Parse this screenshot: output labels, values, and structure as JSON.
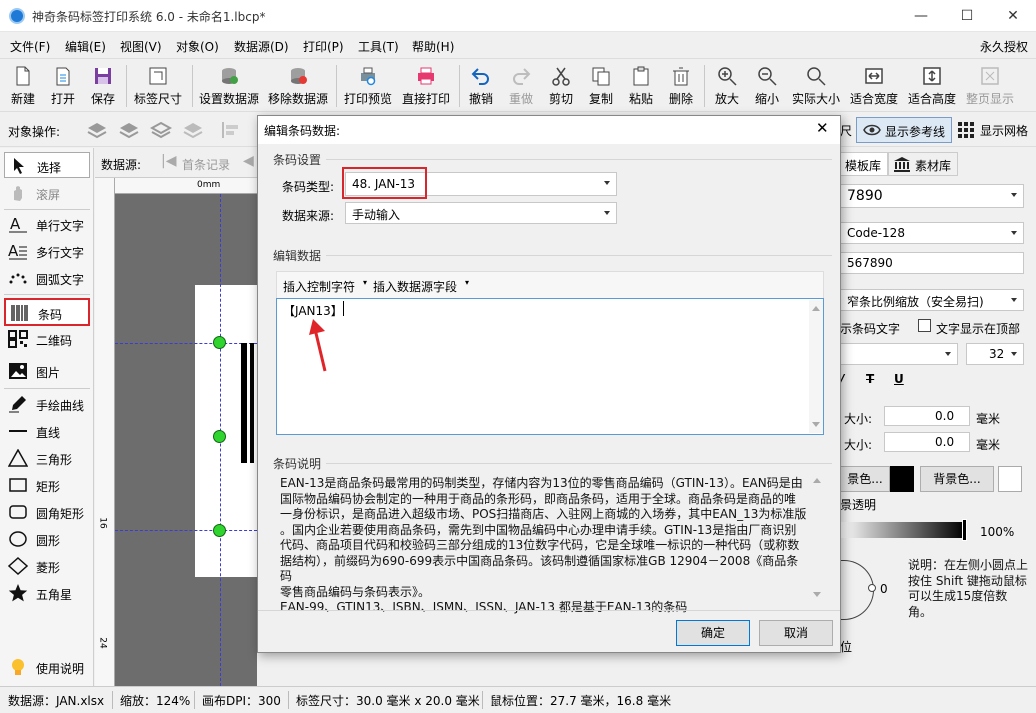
{
  "window": {
    "title": "神奇条码标签打印系统 6.0 - 未命名1.lbcp*",
    "license": "永久授权"
  },
  "menu": [
    "文件(F)",
    "编辑(E)",
    "视图(V)",
    "对象(O)",
    "数据源(D)",
    "打印(P)",
    "工具(T)",
    "帮助(H)"
  ],
  "toolbar": {
    "new": "新建",
    "open": "打开",
    "save": "保存",
    "label_size": "标签尺寸",
    "set_datasource": "设置数据源",
    "remove_datasource": "移除数据源",
    "print_preview": "打印预览",
    "direct_print": "直接打印",
    "undo": "撤销",
    "redo": "重做",
    "cut": "剪切",
    "copy": "复制",
    "paste": "粘贴",
    "delete": "删除",
    "zoom_in": "放大",
    "zoom_out": "缩小",
    "actual_size": "实际大小",
    "fit_width": "适合宽度",
    "fit_height": "适合高度",
    "page_show": "整页显示"
  },
  "objbar": {
    "label": "对象操作:",
    "show_guides": "显示参考线",
    "show_grid": "显示网格",
    "ruler_tail": "尺"
  },
  "left_tools": {
    "select": "选择",
    "scroll": "滚屏",
    "single_text": "单行文字",
    "multi_text": "多行文字",
    "arc_text": "圆弧文字",
    "barcode": "条码",
    "qrcode": "二维码",
    "image": "图片",
    "freehand": "手绘曲线",
    "line": "直线",
    "triangle": "三角形",
    "rect": "矩形",
    "round_rect": "圆角矩形",
    "circle": "圆形",
    "diamond": "菱形",
    "star": "五角星",
    "help": "使用说明"
  },
  "canvas": {
    "datasource_label": "数据源:",
    "first_record": "首条记录",
    "ruler_0": "0mm",
    "ruler_16": "16",
    "ruler_24": "24"
  },
  "right_panel": {
    "tab_templates": "模板库",
    "tab_materials": "素材库",
    "value_field": "7890",
    "type_field": "Code-128",
    "data_field": "567890",
    "scale_mode": "窄条比例缩放（安全易扫)",
    "show_text": "示条码文字",
    "text_top": "文字显示在顶部",
    "font_size": "32",
    "size1_label": "大小:",
    "size1_value": "0.0",
    "size1_unit": "毫米",
    "size2_label": "大小:",
    "size2_value": "0.0",
    "size2_unit": "毫米",
    "fg_color_btn": "景色...",
    "bg_color_btn": "背景色...",
    "transparent": "景透明",
    "opacity": "100%",
    "rotation": "0",
    "rotate_tip": "说明：在左侧小圆点上按住 Shift 键拖动鼠标可以生成15度倍数角。",
    "pos_tail": "位"
  },
  "dialog": {
    "title": "编辑条码数据:",
    "settings_group": "条码设置",
    "barcode_type_label": "条码类型:",
    "barcode_type_value": "48. JAN-13",
    "datasource_label": "数据来源:",
    "datasource_value": "手动输入",
    "edit_group": "编辑数据",
    "insert_ctrl": "插入控制字符",
    "insert_field": "插入数据源字段",
    "editor_content": "【JAN13】",
    "desc_group": "条码说明",
    "desc_lines": [
      "EAN-13是商品条码最常用的码制类型，存储内容为13位的零售商品编码（GTIN-13）。EAN码是由",
      "国际物品编码协会制定的一种用于商品的条形码，即商品条码，适用于全球。商品条码是商品的唯",
      "一身份标识，是商品进入超级市场、POS扫描商店、入驻网上商城的入场券，其中EAN_13为标准版",
      "。国内企业若要使用商品条码，需先到中国物品编码中心办理申请手续。GTIN-13是指由厂商识别",
      "代码、商品项目代码和校验码三部分组成的13位数字代码，它是全球唯一标识的一种代码（或称数",
      "据结构），前缀码为690-699表示中国商品条码。该码制遵循国家标准GB 12904－2008《商品条码",
      "零售商品编码与条码表示》。",
      "EAN-99、GTIN13、ISBN、ISMN、ISSN、JAN-13 都是基于EAN-13的条码"
    ],
    "ok": "确定",
    "cancel": "取消"
  },
  "status": {
    "datasource": "数据源：JAN.xlsx",
    "zoom": "缩放：124%",
    "dpi": "画布DPI：300",
    "label_size": "标签尺寸：30.0 毫米 x 20.0 毫米",
    "mouse_pos": "鼠标位置：27.7 毫米，16.8 毫米"
  },
  "colors": {
    "accent": "#0078d7",
    "highlight": "#d9262c",
    "handle": "#2fd42f"
  }
}
